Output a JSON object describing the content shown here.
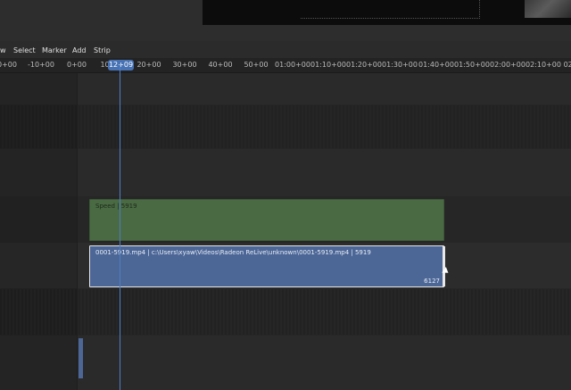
{
  "menu": {
    "items": [
      {
        "label": "w"
      },
      {
        "label": "Select"
      },
      {
        "label": "Marker"
      },
      {
        "label": "Add"
      },
      {
        "label": "Strip"
      }
    ]
  },
  "ruler": {
    "ticks": [
      "0+00",
      "-10+00",
      "0+00",
      "10+00",
      "20+00",
      "30+00",
      "40+00",
      "50+00",
      "01:00+00",
      "01:10+00",
      "01:20+00",
      "01:30+00",
      "01:40+00",
      "01:50+00",
      "02:00+00",
      "02:10+00",
      "02:"
    ],
    "playhead_label": "12+09"
  },
  "strips": {
    "speed": {
      "label": "Speed | 5919"
    },
    "movie": {
      "label": "0001-5919.mp4 | c:\\Users\\xyaw\\Videos\\Radeon ReLive\\unknown\\0001-5919.mp4 | 5919",
      "end_frame": "6127"
    }
  },
  "colors": {
    "speed_strip": "#496a42",
    "movie_strip": "#4c6696",
    "playhead": "#4772b3"
  }
}
